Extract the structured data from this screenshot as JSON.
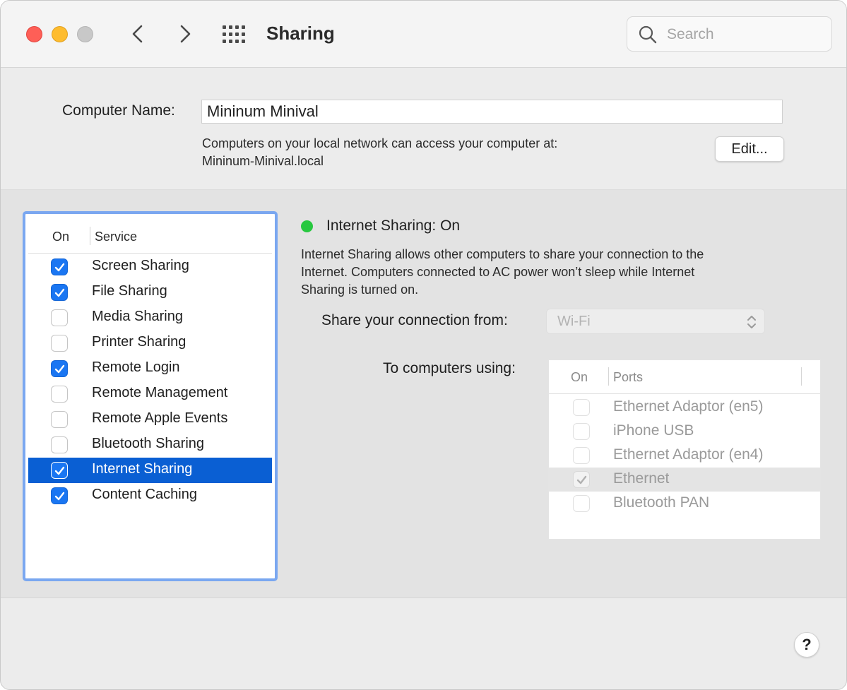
{
  "window": {
    "title": "Sharing",
    "search_placeholder": "Search"
  },
  "computer_name": {
    "label": "Computer Name:",
    "value": "Mininum Minival",
    "description_line1": "Computers on your local network can access your computer at:",
    "description_line2": "Mininum-Minival.local",
    "edit_label": "Edit..."
  },
  "services": {
    "header_on": "On",
    "header_service": "Service",
    "items": [
      {
        "label": "Screen Sharing",
        "checked": true
      },
      {
        "label": "File Sharing",
        "checked": true
      },
      {
        "label": "Media Sharing",
        "checked": false
      },
      {
        "label": "Printer Sharing",
        "checked": false
      },
      {
        "label": "Remote Login",
        "checked": true
      },
      {
        "label": "Remote Management",
        "checked": false
      },
      {
        "label": "Remote Apple Events",
        "checked": false
      },
      {
        "label": "Bluetooth Sharing",
        "checked": false
      },
      {
        "label": "Internet Sharing",
        "checked": true,
        "selected": true
      },
      {
        "label": "Content Caching",
        "checked": true
      }
    ]
  },
  "detail": {
    "status": "Internet Sharing: On",
    "status_color": "#28c840",
    "description_line1": "Internet Sharing allows other computers to share your connection to the",
    "description_line2": "Internet. Computers connected to AC power won’t sleep while Internet",
    "description_line3": "Sharing is turned on.",
    "share_from_label": "Share your connection from:",
    "share_from_value": "Wi-Fi",
    "to_label": "To computers using:",
    "ports_header_on": "On",
    "ports_header_ports": "Ports",
    "ports": [
      {
        "label": "Ethernet Adaptor (en5)",
        "checked": false
      },
      {
        "label": "iPhone USB",
        "checked": false
      },
      {
        "label": "Ethernet Adaptor (en4)",
        "checked": false
      },
      {
        "label": "Ethernet",
        "checked": true,
        "highlight": true
      },
      {
        "label": "Bluetooth PAN",
        "checked": false
      }
    ]
  },
  "help_label": "?",
  "colors": {
    "accent": "#1a76f2",
    "selection": "#0a5fd3",
    "focus_ring": "#7aa7f0"
  }
}
